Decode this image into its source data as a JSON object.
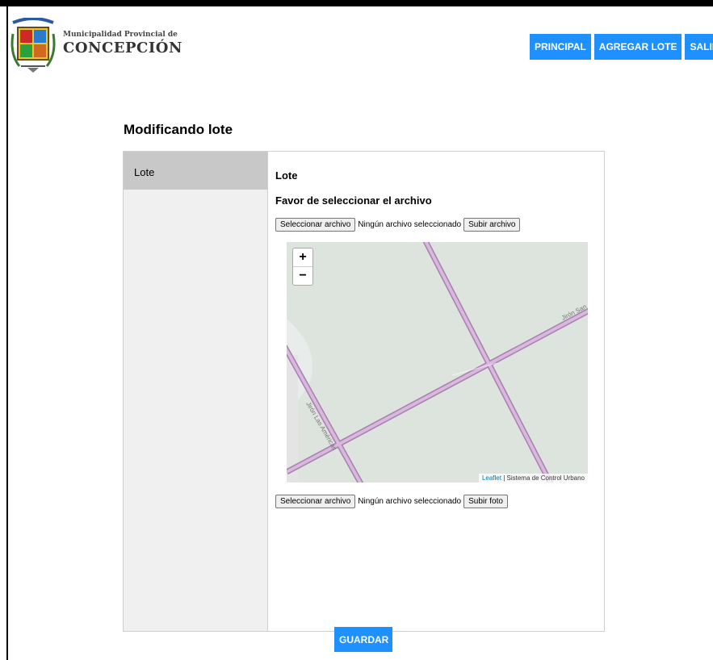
{
  "header": {
    "brand_sub": "Municipalidad Provincial de",
    "brand_main": "CONCEPCIÓN"
  },
  "nav": {
    "principal": "PRINCIPAL",
    "agregar_lote": "AGREGAR LOTE",
    "salir": "SALIR"
  },
  "page": {
    "title": "Modificando lote"
  },
  "sidebar": {
    "items": [
      {
        "label": "Lote"
      }
    ]
  },
  "form": {
    "section_title": "Lote",
    "subtitle": "Favor de seleccionar el archivo",
    "file1": {
      "choose_label": "Seleccionar archivo",
      "status": "Ningún archivo seleccionado",
      "upload_label": "Subir archivo"
    },
    "file2": {
      "choose_label": "Seleccionar archivo",
      "status": "Ningún archivo seleccionado",
      "upload_label": "Subir foto"
    }
  },
  "map": {
    "zoom_in": "+",
    "zoom_out": "−",
    "street_label_1": "Jirón San",
    "street_label_2": "Jirón Las Américas",
    "attribution_link": "Leaflet",
    "attribution_text": " | Sistema de Control Urbano",
    "colors": {
      "land": "#dde3dd",
      "road": "#c9a8cf",
      "road_edge": "#a87fb0"
    }
  },
  "actions": {
    "save_label": "GUARDAR"
  },
  "colors": {
    "accent": "#1e90ff"
  }
}
